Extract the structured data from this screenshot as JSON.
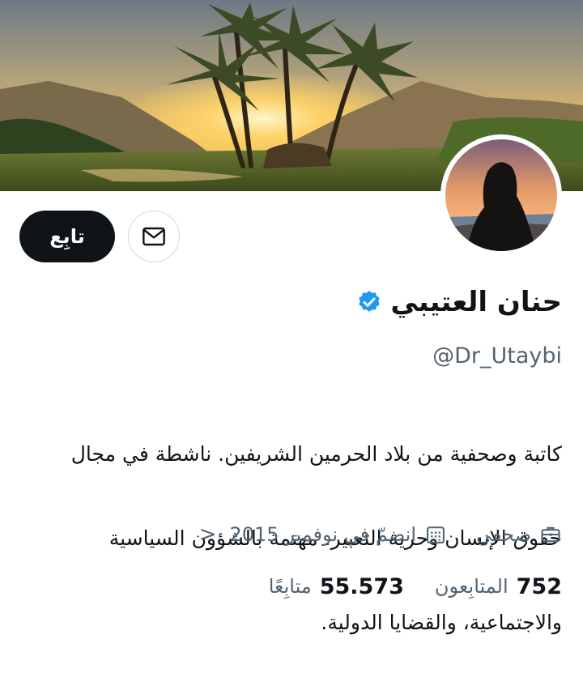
{
  "profile": {
    "name": "حنان العتيبي",
    "handle": "@Dr_Utaybi",
    "verified": true,
    "bio_lines": [
      "كاتبة وصحفية من بلاد الحرمين الشريفين.  ناشطة في مجال",
      "حقوق الإنسان وحرية التعبير.  مهتمة بالشؤون السياسية",
      "والاجتماعية، والقضايا الدولية."
    ],
    "profession": "صحفي",
    "joined": "انضمّ في نوفمبر 2015",
    "chevron": "<"
  },
  "actions": {
    "follow_label": "تابِع",
    "message_icon": "mail-icon"
  },
  "stats": {
    "followers_count": "752",
    "followers_label": "المتابِعون",
    "following_count": "55.573",
    "following_label": "متابِعًا"
  },
  "colors": {
    "accent_blue": "#1d9bf0",
    "text_primary": "#0f1419",
    "text_secondary": "#536471",
    "border": "#cfd9de"
  }
}
